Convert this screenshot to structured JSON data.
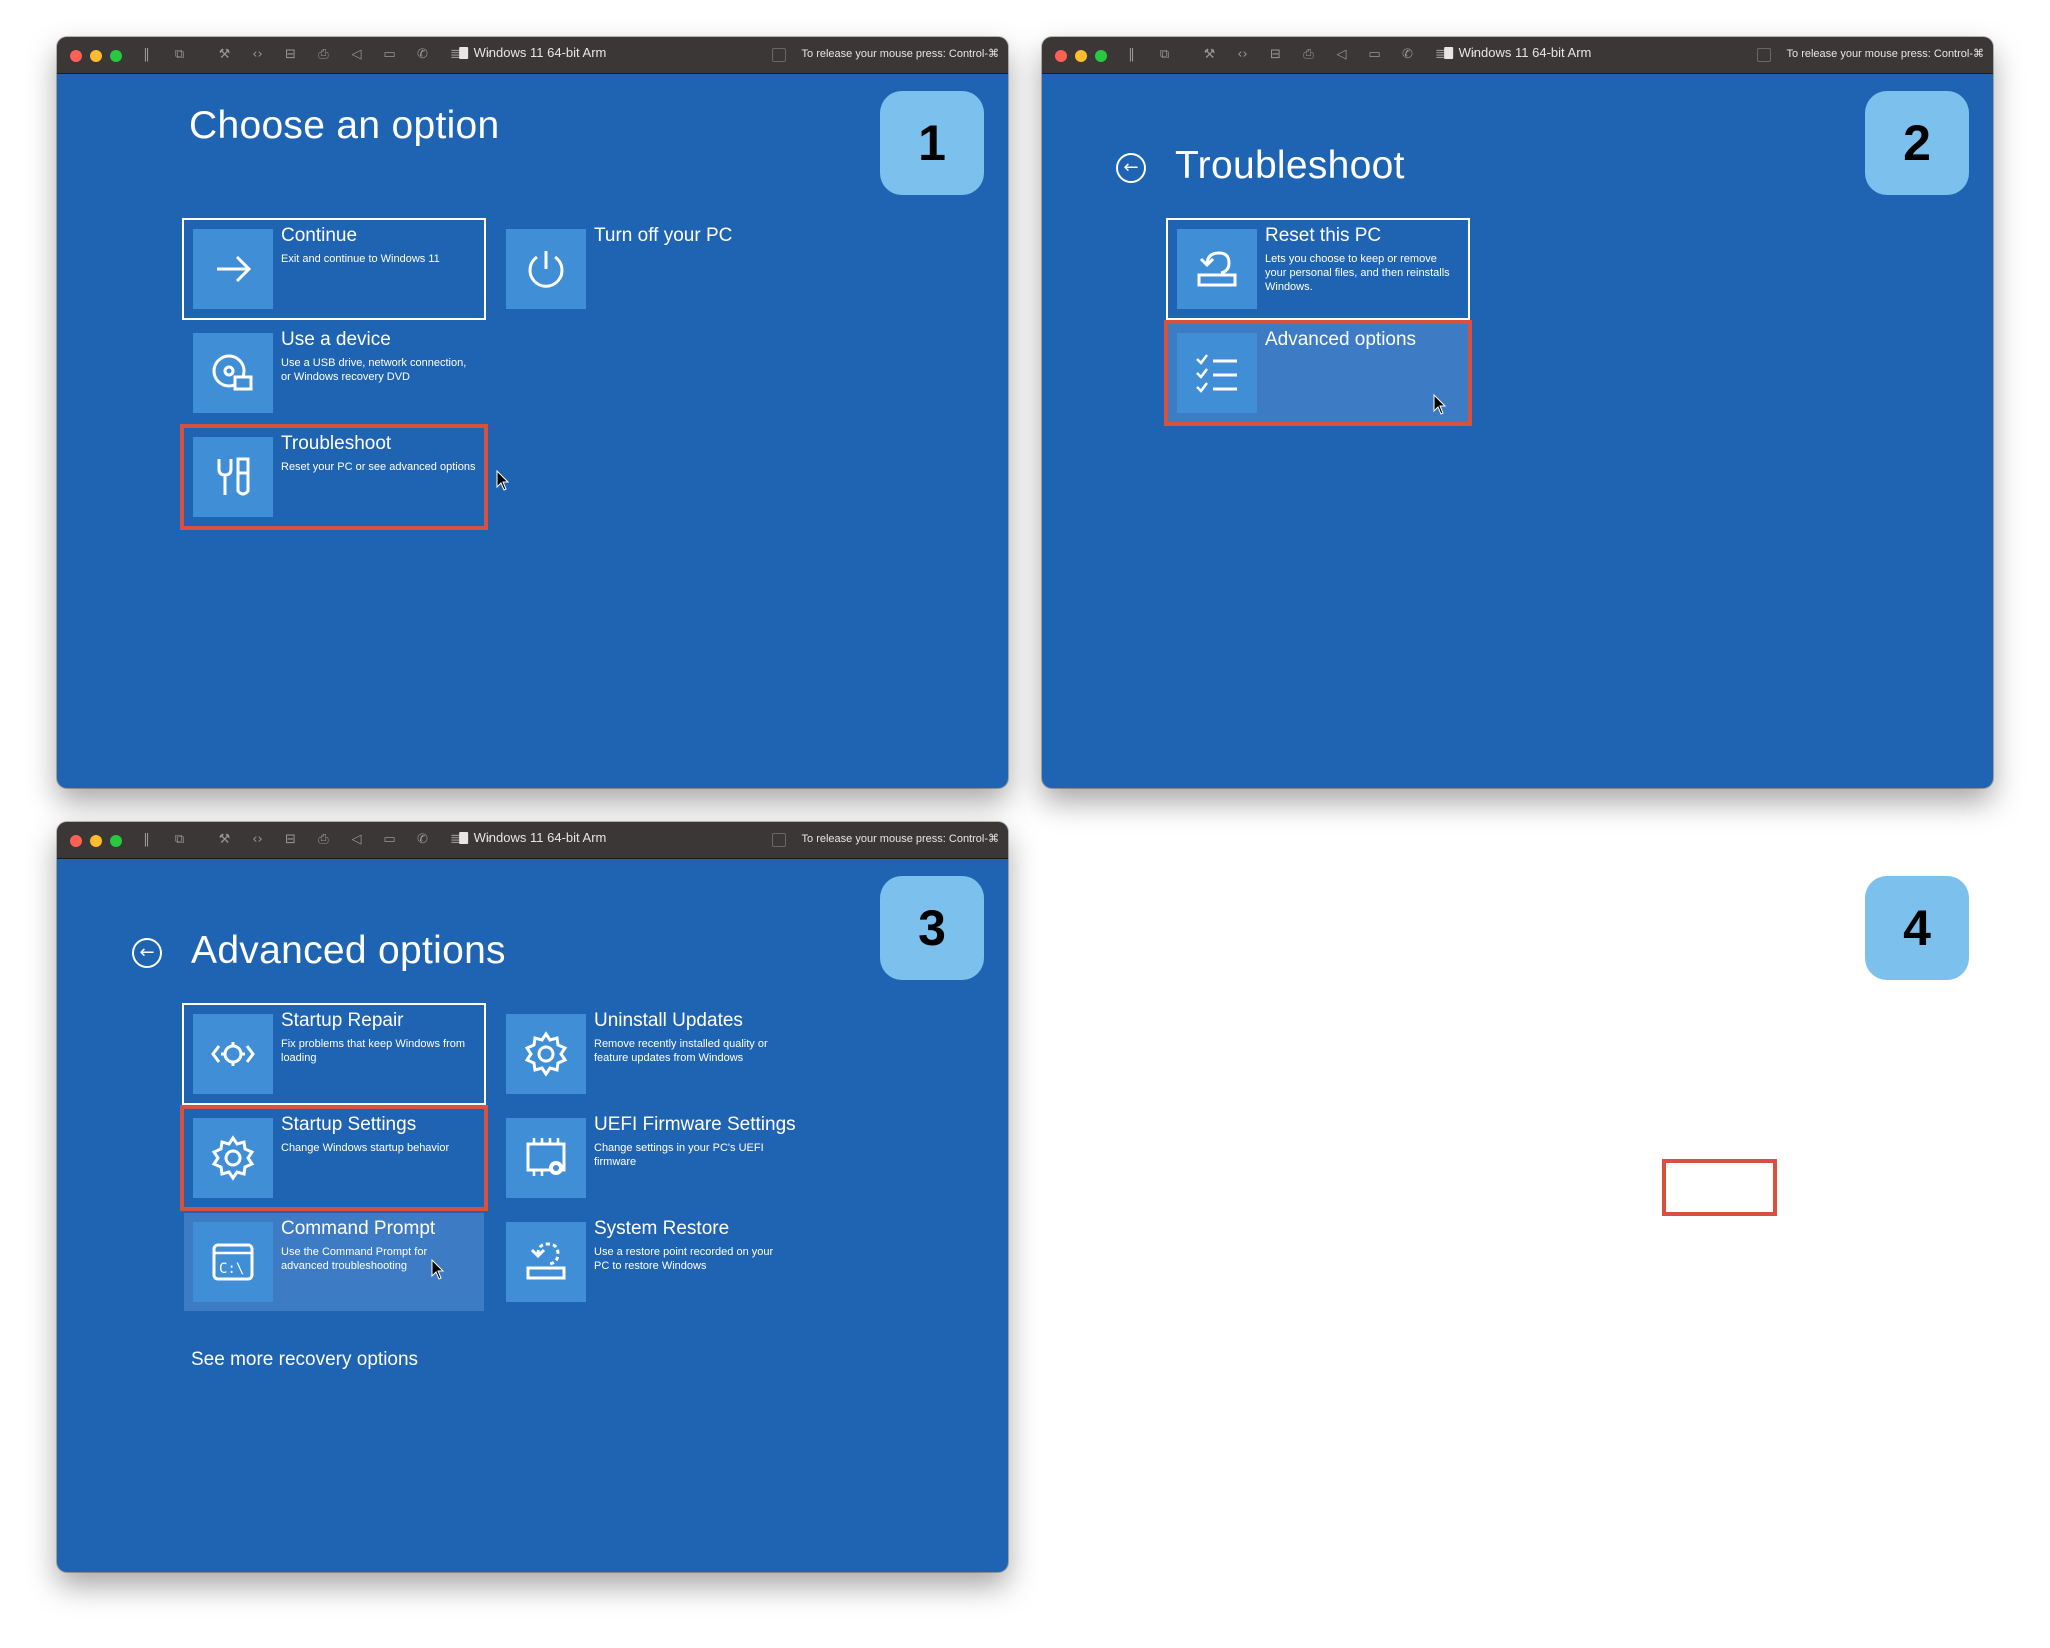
{
  "window": {
    "title": "Windows 11 64-bit Arm",
    "release_hint": "To release your mouse press: Control-⌘"
  },
  "panels": {
    "p1": {
      "badge": "1",
      "heading": "Choose an option",
      "tiles": [
        {
          "title": "Continue",
          "desc": "Exit and continue to Windows 11",
          "icon": "arrow-right-icon",
          "state": "selected"
        },
        {
          "title": "Turn off your PC",
          "desc": "",
          "icon": "power-icon",
          "state": "normal"
        },
        {
          "title": "Use a device",
          "desc": "Use a USB drive, network connection, or Windows recovery DVD",
          "icon": "device-icon",
          "state": "normal"
        },
        {
          "title": "Troubleshoot",
          "desc": "Reset your PC or see advanced options",
          "icon": "tools-icon",
          "state": "highlighted"
        }
      ]
    },
    "p2": {
      "badge": "2",
      "heading": "Troubleshoot",
      "tiles": [
        {
          "title": "Reset this PC",
          "desc": "Lets you choose to keep or remove your personal files, and then reinstalls Windows.",
          "icon": "reset-pc-icon",
          "state": "selected"
        },
        {
          "title": "Advanced options",
          "desc": "",
          "icon": "checklist-icon",
          "state": "highlighted"
        }
      ]
    },
    "p3": {
      "badge": "3",
      "heading": "Advanced options",
      "tiles": [
        {
          "title": "Startup Repair",
          "desc": "Fix problems that keep Windows from loading",
          "icon": "startup-repair-icon",
          "state": "selected"
        },
        {
          "title": "Uninstall Updates",
          "desc": "Remove recently installed quality or feature updates from Windows",
          "icon": "gear-icon",
          "state": "normal"
        },
        {
          "title": "Startup Settings",
          "desc": "Change Windows startup behavior",
          "icon": "gear-icon",
          "state": "highlighted"
        },
        {
          "title": "UEFI Firmware Settings",
          "desc": "Change settings in your PC's UEFI firmware",
          "icon": "chip-gear-icon",
          "state": "normal"
        },
        {
          "title": "Command Prompt",
          "desc": "Use the Command Prompt for advanced troubleshooting",
          "icon": "command-prompt-icon",
          "state": "hover"
        },
        {
          "title": "System Restore",
          "desc": "Use a restore point recorded on your PC to restore Windows",
          "icon": "system-restore-icon",
          "state": "normal"
        }
      ],
      "more_link": "See more recovery options"
    },
    "p4": {
      "badge": "4"
    }
  },
  "colors": {
    "recovery_blue": "#1f64b2",
    "tile_icon_bg": "#3f8ed6",
    "highlight_red": "#d6513f",
    "badge_blue": "#7cc0ee"
  }
}
